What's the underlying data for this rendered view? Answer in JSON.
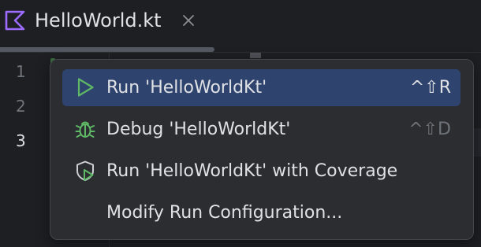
{
  "tab": {
    "title": "HelloWorld.kt",
    "file_icon": "kotlin-file-icon",
    "close_icon": "close-icon"
  },
  "gutter": {
    "line_numbers": [
      "1",
      "2",
      "3"
    ],
    "current_line": "3"
  },
  "popup": {
    "items": [
      {
        "label": "Run 'HelloWorldKt'",
        "shortcut": "^⇧R",
        "icon": "run-icon",
        "selected": true
      },
      {
        "label": "Debug 'HelloWorldKt'",
        "shortcut": "^⇧D",
        "icon": "debug-bug-icon",
        "selected": false
      },
      {
        "label": "Run 'HelloWorldKt' with Coverage",
        "shortcut": "",
        "icon": "coverage-shield-icon",
        "selected": false
      },
      {
        "label": "Modify Run Configuration...",
        "shortcut": "",
        "icon": "",
        "selected": false
      }
    ]
  },
  "colors": {
    "background": "#1e1f22",
    "popup_background": "#2b2d30",
    "selection": "#2e436e",
    "run_green": "#5fb865",
    "kotlin_purple": "#9c6bff"
  }
}
